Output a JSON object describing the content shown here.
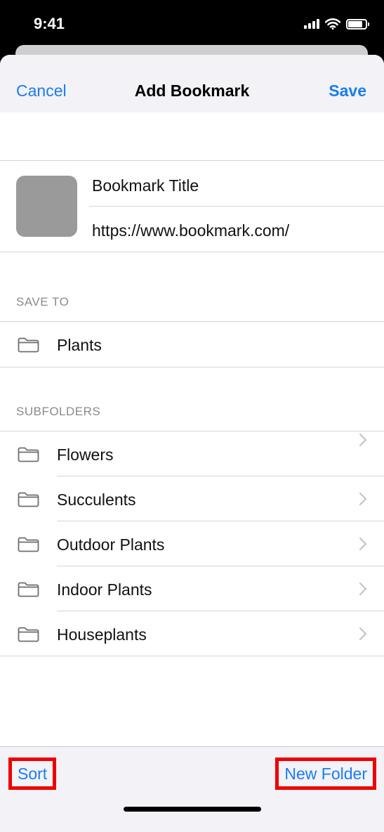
{
  "status_bar": {
    "time": "9:41",
    "battery_level": 0.85
  },
  "nav": {
    "cancel_label": "Cancel",
    "title": "Add Bookmark",
    "save_label": "Save"
  },
  "bookmark": {
    "title": "Bookmark Title",
    "url": "https://www.bookmark.com/"
  },
  "save_to": {
    "header": "SAVE TO",
    "folder": "Plants"
  },
  "subfolders": {
    "header": "SUBFOLDERS",
    "items": [
      {
        "label": "Flowers"
      },
      {
        "label": "Succulents"
      },
      {
        "label": "Outdoor Plants"
      },
      {
        "label": "Indoor Plants"
      },
      {
        "label": "Houseplants"
      }
    ]
  },
  "toolbar": {
    "sort_label": "Sort",
    "new_folder_label": "New Folder"
  },
  "icons": {
    "folder": "folder-icon",
    "chevron": "chevron-right-icon"
  },
  "colors": {
    "accent": "#1a7cf5",
    "highlight_box": "#ee0000",
    "background": "#f2f2f7"
  }
}
